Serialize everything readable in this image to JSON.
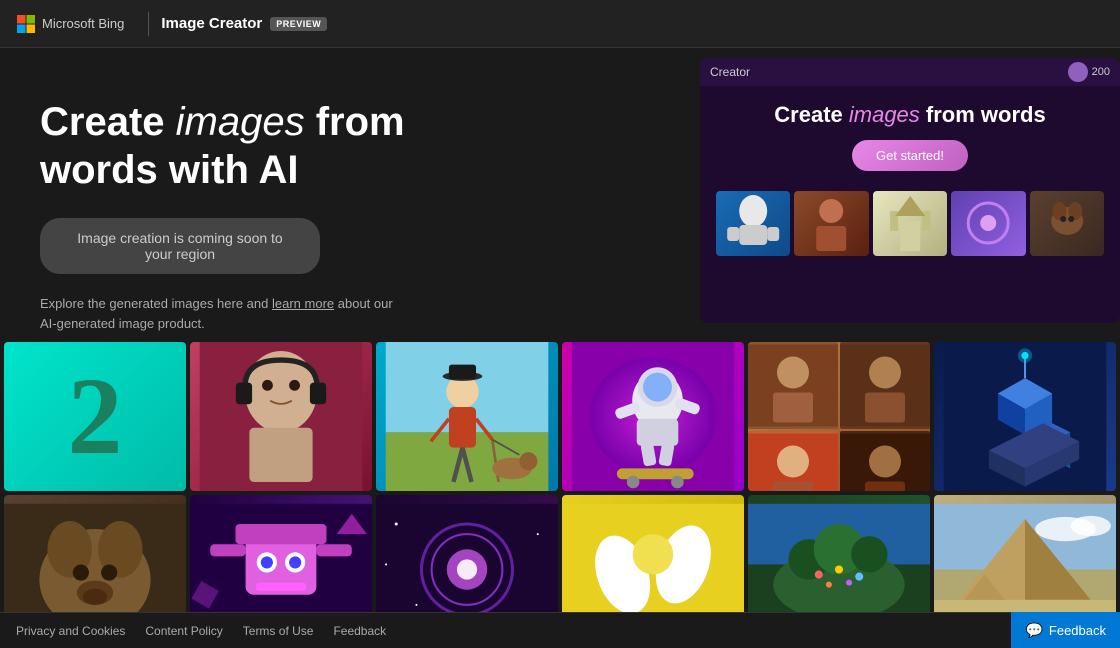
{
  "header": {
    "ms_bing_label": "Microsoft Bing",
    "image_creator_label": "Image Creator",
    "preview_badge": "PREVIEW",
    "search_icon": "🔍"
  },
  "hero": {
    "title_part1": "Create ",
    "title_italic": "images",
    "title_part2": " from",
    "title_line2": "words with AI",
    "coming_soon_btn": "Image creation is coming soon to your region",
    "explore_text_before": "Explore the generated images here and ",
    "explore_link": "learn more",
    "explore_text_after": " about our AI-generated image product.",
    "preview_window_label": "Creator",
    "preview_title_part1": "Create ",
    "preview_title_italic": "images",
    "preview_title_part2": " from words",
    "get_started_btn": "Get started!"
  },
  "footer": {
    "privacy_link": "Privacy and Cookies",
    "content_policy_link": "Content Policy",
    "terms_link": "Terms of Use",
    "feedback_link": "Feedback",
    "feedback_btn": "Feedback"
  },
  "grid": {
    "items": [
      {
        "id": "number2",
        "alt": "Number 2 on teal background"
      },
      {
        "id": "statue",
        "alt": "Greek statue with headphones"
      },
      {
        "id": "oldman",
        "alt": "Old man walking dog"
      },
      {
        "id": "astronaut-skate",
        "alt": "Astronaut skateboarding"
      },
      {
        "id": "portraits",
        "alt": "Portrait grid collage"
      },
      {
        "id": "city-iso",
        "alt": "Isometric city"
      },
      {
        "id": "pug",
        "alt": "Pug dog"
      },
      {
        "id": "robot",
        "alt": "Robot character"
      },
      {
        "id": "portal",
        "alt": "Space portal"
      },
      {
        "id": "yellow-hands",
        "alt": "Yellow abstract hands"
      },
      {
        "id": "island",
        "alt": "Fantasy island"
      },
      {
        "id": "pyramid",
        "alt": "Pyramid landscape"
      }
    ]
  }
}
